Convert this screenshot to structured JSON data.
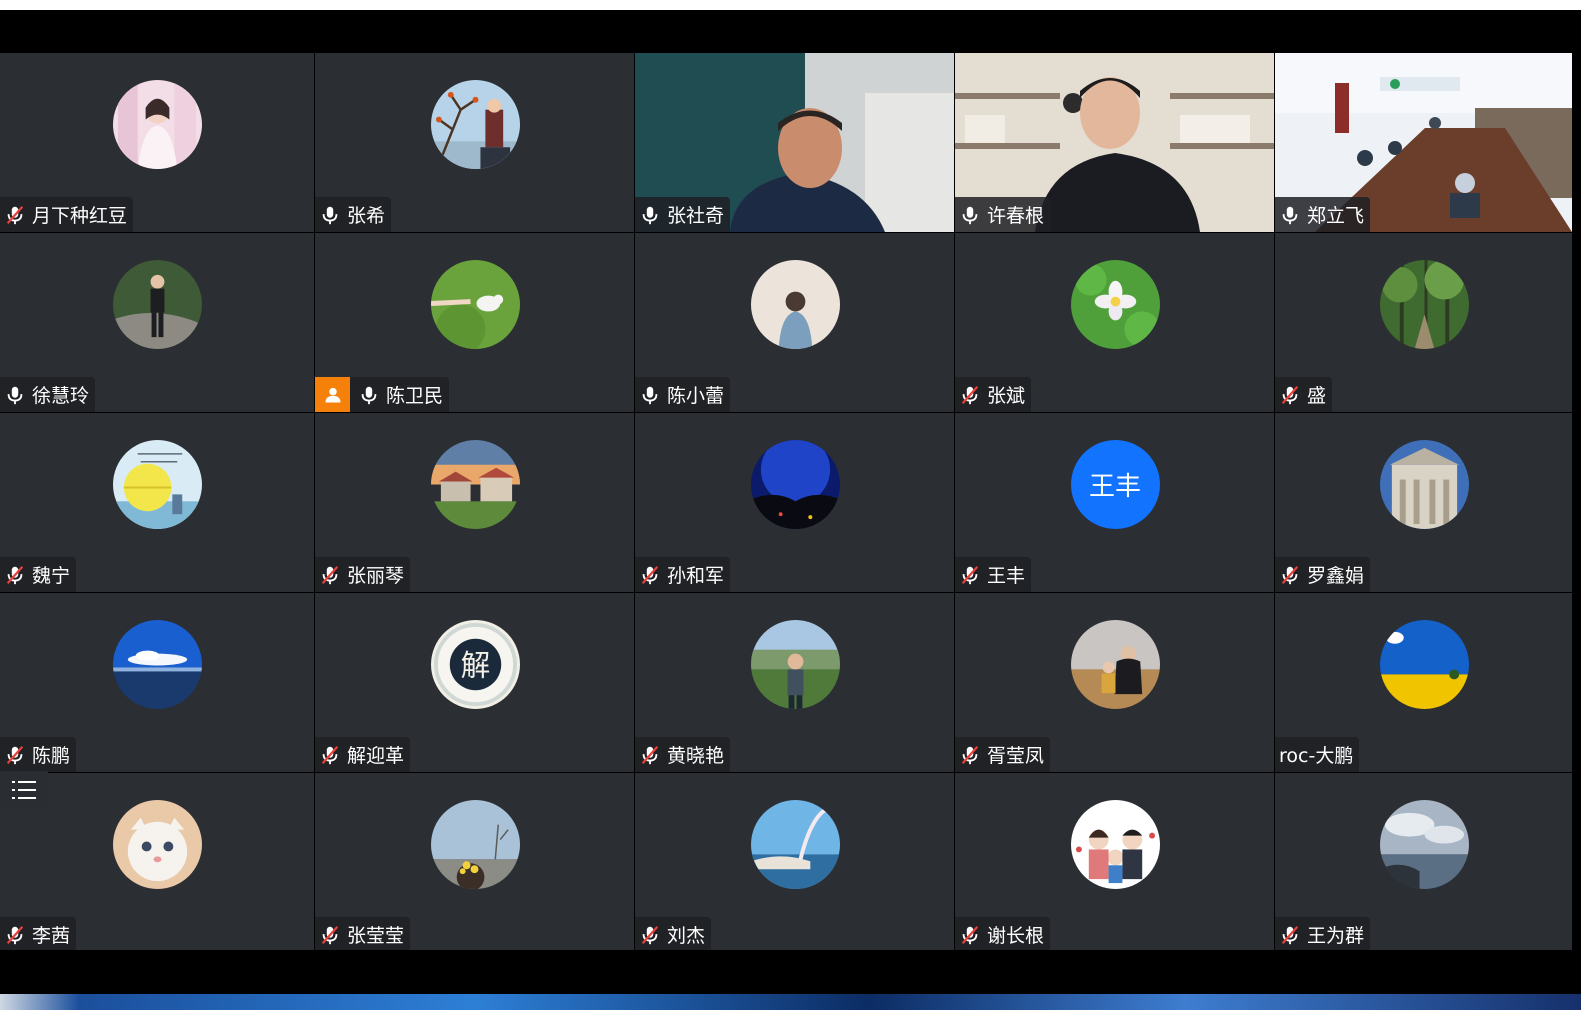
{
  "participants": [
    {
      "name": "月下种红豆",
      "mic": "muted"
    },
    {
      "name": "张希",
      "mic": "on"
    },
    {
      "name": "张社奇",
      "mic": "on"
    },
    {
      "name": "许春根",
      "mic": "on"
    },
    {
      "name": "郑立飞",
      "mic": "on"
    },
    {
      "name": "徐慧玲",
      "mic": "on"
    },
    {
      "name": "陈卫民",
      "mic": "on",
      "host": true
    },
    {
      "name": "陈小蕾",
      "mic": "on"
    },
    {
      "name": "张斌",
      "mic": "muted"
    },
    {
      "name": "盛",
      "mic": "muted"
    },
    {
      "name": "魏宁",
      "mic": "muted"
    },
    {
      "name": "张丽琴",
      "mic": "muted"
    },
    {
      "name": "孙和军",
      "mic": "muted"
    },
    {
      "name": "王丰",
      "mic": "muted",
      "avatar_text": "王丰"
    },
    {
      "name": "罗鑫娟",
      "mic": "muted"
    },
    {
      "name": "陈鹏",
      "mic": "muted"
    },
    {
      "name": "解迎革",
      "mic": "muted",
      "avatar_text": "解"
    },
    {
      "name": "黄晓艳",
      "mic": "muted"
    },
    {
      "name": "胥莹凤",
      "mic": "muted"
    },
    {
      "name": "roc-大鹏",
      "mic": "none"
    },
    {
      "name": "李茜",
      "mic": "muted"
    },
    {
      "name": "张莹莹",
      "mic": "muted"
    },
    {
      "name": "刘杰",
      "mic": "muted"
    },
    {
      "name": "谢长根",
      "mic": "muted"
    },
    {
      "name": "王为群",
      "mic": "muted"
    }
  ],
  "colors": {
    "tile_bg": "#2b2e33",
    "muted_slash": "#e8403a",
    "host_badge": "#f5800a",
    "text_avatar": "#1273ff"
  },
  "icons": {
    "mic": "microphone-icon",
    "mic_muted": "microphone-muted-icon",
    "host": "person-icon",
    "list": "list-menu-icon"
  }
}
